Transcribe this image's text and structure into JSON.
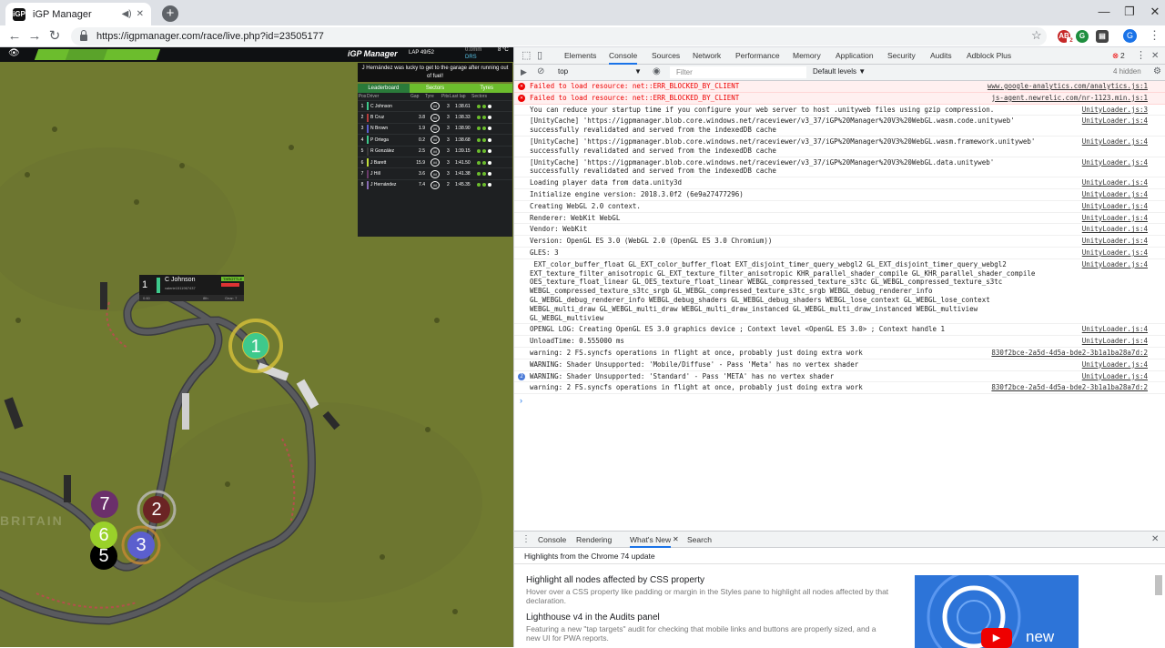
{
  "browser": {
    "tab_title": "iGP Manager",
    "url": "https://igpmanager.com/race/live.php?id=23505177",
    "ext_badge": "2",
    "account_initial": "G"
  },
  "game": {
    "logo": "iGP Manager",
    "lap": "LAP 49/52",
    "weather": "0.0mm",
    "drs": "DRS",
    "temp": "8 °C",
    "message": "J Hernández was lucky to get to the garage after running out of fuel!",
    "map_label": "BRITAIN",
    "leaderboard": {
      "tabs": [
        "Leaderboard",
        "Sectors",
        "Tyres"
      ],
      "headers": [
        "Pos",
        "Driver",
        "Gap",
        "Tyre",
        "Pits",
        "Last lap",
        "Sectors"
      ],
      "rows": [
        {
          "pos": "1",
          "name": "C Johnson",
          "gap": "",
          "tyre": "M",
          "pits": "3",
          "last": "1:38.61",
          "color": "#3ec98c"
        },
        {
          "pos": "2",
          "name": "B Cruz",
          "gap": "3.8",
          "tyre": "M",
          "pits": "3",
          "last": "1:38.33",
          "color": "#b53b3b"
        },
        {
          "pos": "3",
          "name": "N Brown",
          "gap": "1.9",
          "tyre": "M",
          "pits": "3",
          "last": "1:38.90",
          "color": "#5b5fce"
        },
        {
          "pos": "4",
          "name": "P Ortega",
          "gap": "0.2",
          "tyre": "M",
          "pits": "3",
          "last": "1:38.68",
          "color": "#3ec98c"
        },
        {
          "pos": "5",
          "name": "R González",
          "gap": "2.5",
          "tyre": "M",
          "pits": "3",
          "last": "1:39.15",
          "color": "#3a3a3a"
        },
        {
          "pos": "6",
          "name": "J Barett",
          "gap": "15.9",
          "tyre": "M",
          "pits": "3",
          "last": "1:41.50",
          "color": "#c3e03a"
        },
        {
          "pos": "7",
          "name": "J Hill",
          "gap": "3.6",
          "tyre": "M",
          "pits": "3",
          "last": "1:41.38",
          "color": "#6b3a6b"
        },
        {
          "pos": "8",
          "name": "J Hernández",
          "gap": "7.4",
          "tyre": "M",
          "pits": "2",
          "last": "1:45.35",
          "color": "#8a6bb5"
        }
      ]
    },
    "car_tag": {
      "pos": "1",
      "name": "C Johnson",
      "team": "valerie1511967437",
      "mode": "THROTTLE",
      "gap": "0.60",
      "stat1": "8th",
      "stat2": "Gear: 7"
    },
    "markers": [
      {
        "label": "1",
        "color": "#3ec98c"
      },
      {
        "label": "2",
        "color": "#6b2424"
      },
      {
        "label": "3",
        "color": "#5b5fce"
      },
      {
        "label": "5",
        "color": "#000000"
      },
      {
        "label": "6",
        "color": "#9ad12a"
      },
      {
        "label": "7",
        "color": "#6b2f6b"
      }
    ]
  },
  "devtools": {
    "tabs": [
      "Elements",
      "Console",
      "Sources",
      "Network",
      "Performance",
      "Memory",
      "Application",
      "Security",
      "Audits",
      "Adblock Plus"
    ],
    "error_count": "2",
    "context": "top",
    "filter_placeholder": "Filter",
    "levels": "Default levels ▼",
    "hidden": "4 hidden",
    "console": [
      {
        "type": "err",
        "text": "Failed to load resource: net::ERR_BLOCKED_BY_CLIENT",
        "src": "www.google-analytics.com/analytics.js:1"
      },
      {
        "type": "err",
        "text": "Failed to load resource: net::ERR_BLOCKED_BY_CLIENT",
        "src": "js-agent.newrelic.com/nr-1123.min.js:1"
      },
      {
        "type": "log",
        "text": "You can reduce your startup time if you configure your web server to host .unityweb files using gzip compression.",
        "src": "UnityLoader.js:3"
      },
      {
        "type": "log",
        "text": "[UnityCache] 'https://igpmanager.blob.core.windows.net/raceviewer/v3_37/iGP%20Manager%20V3%20WebGL.wasm.code.unityweb' successfully revalidated and served from the indexedDB cache",
        "src": "UnityLoader.js:4"
      },
      {
        "type": "log",
        "text": "[UnityCache] 'https://igpmanager.blob.core.windows.net/raceviewer/v3_37/iGP%20Manager%20V3%20WebGL.wasm.framework.unityweb' successfully revalidated and served from the indexedDB cache",
        "src": "UnityLoader.js:4"
      },
      {
        "type": "log",
        "text": "[UnityCache] 'https://igpmanager.blob.core.windows.net/raceviewer/v3_37/iGP%20Manager%20V3%20WebGL.data.unityweb' successfully revalidated and served from the indexedDB cache",
        "src": "UnityLoader.js:4"
      },
      {
        "type": "log",
        "text": "Loading player data from data.unity3d",
        "src": "UnityLoader.js:4"
      },
      {
        "type": "log",
        "text": "Initialize engine version: 2018.3.0f2 (6e9a27477296)",
        "src": "UnityLoader.js:4"
      },
      {
        "type": "log",
        "text": "Creating WebGL 2.0 context.",
        "src": "UnityLoader.js:4"
      },
      {
        "type": "log",
        "text": "Renderer: WebKit WebGL",
        "src": "UnityLoader.js:4"
      },
      {
        "type": "log",
        "text": "Vendor: WebKit",
        "src": "UnityLoader.js:4"
      },
      {
        "type": "log",
        "text": "Version: OpenGL ES 3.0 (WebGL 2.0 (OpenGL ES 3.0 Chromium))",
        "src": "UnityLoader.js:4"
      },
      {
        "type": "log",
        "text": "GLES: 3",
        "src": "UnityLoader.js:4"
      },
      {
        "type": "log",
        "text": " EXT_color_buffer_float GL_EXT_color_buffer_float EXT_disjoint_timer_query_webgl2 GL_EXT_disjoint_timer_query_webgl2 EXT_texture_filter_anisotropic GL_EXT_texture_filter_anisotropic KHR_parallel_shader_compile GL_KHR_parallel_shader_compile OES_texture_float_linear GL_OES_texture_float_linear WEBGL_compressed_texture_s3tc GL_WEBGL_compressed_texture_s3tc WEBGL_compressed_texture_s3tc_srgb GL_WEBGL_compressed_texture_s3tc_srgb WEBGL_debug_renderer_info GL_WEBGL_debug_renderer_info WEBGL_debug_shaders GL_WEBGL_debug_shaders WEBGL_lose_context GL_WEBGL_lose_context WEBGL_multi_draw GL_WEBGL_multi_draw WEBGL_multi_draw_instanced GL_WEBGL_multi_draw_instanced WEBGL_multiview GL_WEBGL_multiview",
        "src": "UnityLoader.js:4"
      },
      {
        "type": "log",
        "text": "OPENGL LOG: Creating OpenGL ES 3.0 graphics device ; Context level <OpenGL ES 3.0> ; Context handle 1",
        "src": "UnityLoader.js:4"
      },
      {
        "type": "log",
        "text": "UnloadTime: 0.555000 ms",
        "src": "UnityLoader.js:4"
      },
      {
        "type": "log",
        "text": "warning: 2 FS.syncfs operations in flight at once, probably just doing extra work",
        "src": "830f2bce-2a5d-4d5a-bde2-3b1a1ba28a7d:2"
      },
      {
        "type": "log",
        "text": "WARNING: Shader Unsupported: 'Mobile/Diffuse' - Pass 'Meta' has no vertex shader",
        "src": "UnityLoader.js:4"
      },
      {
        "type": "log",
        "text": "WARNING: Shader Unsupported: 'Standard' - Pass 'META' has no vertex shader",
        "src": "UnityLoader.js:4",
        "badge": "2"
      },
      {
        "type": "log",
        "text": "warning: 2 FS.syncfs operations in flight at once, probably just doing extra work",
        "src": "830f2bce-2a5d-4d5a-bde2-3b1a1ba28a7d:2"
      }
    ],
    "prompt": "›",
    "drawer_tabs": [
      "Console",
      "Rendering",
      "What's New",
      "Search"
    ],
    "drawer_heading": "Highlights from the Chrome 74 update",
    "whats_new": [
      {
        "title": "Highlight all nodes affected by CSS property",
        "desc": "Hover over a CSS property like padding or margin in the Styles pane to highlight all nodes affected by that declaration."
      },
      {
        "title": "Lighthouse v4 in the Audits panel",
        "desc": "Featuring a new \"tap targets\" audit for checking that mobile links and buttons are properly sized, and a new UI for PWA reports."
      }
    ],
    "video_caption": "new"
  }
}
